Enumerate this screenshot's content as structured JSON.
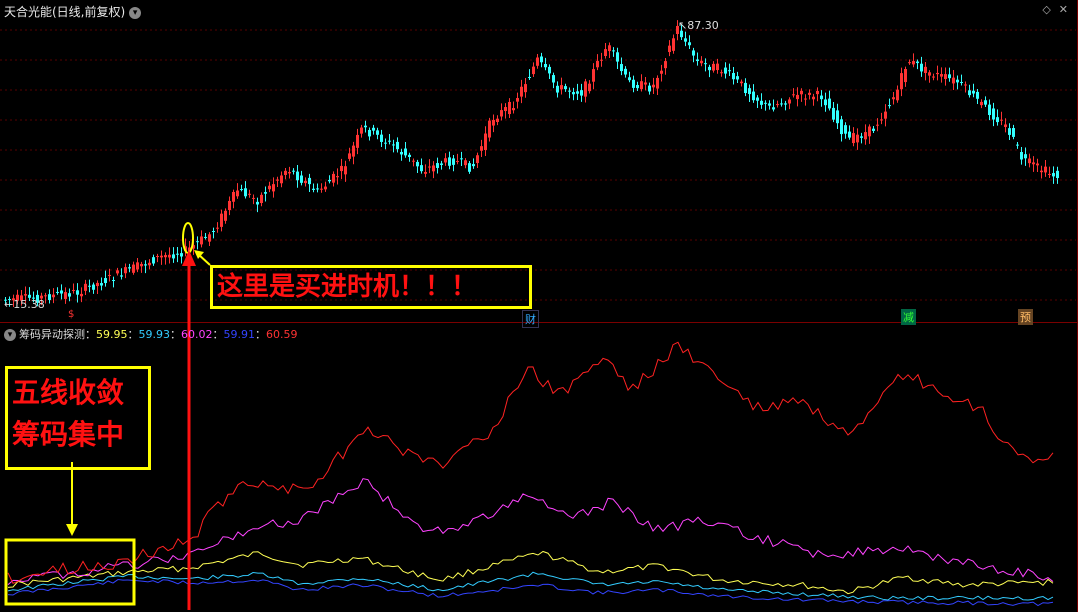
{
  "header": {
    "title": "天合光能(日线,前复权)",
    "icons": [
      "diamond-icon",
      "close-icon"
    ]
  },
  "price_labels": {
    "high": "87.30",
    "low": "15.38"
  },
  "indicator": {
    "name": "筹码异动探测",
    "values": [
      "59.95",
      "59.93",
      "60.02",
      "59.91",
      "60.59"
    ],
    "colors": [
      "#ffff55",
      "#33ccff",
      "#ff44ff",
      "#3344ff",
      "#ff3333"
    ]
  },
  "event_tags": {
    "s": "$",
    "cai": "财",
    "jian": "减",
    "yu": "预"
  },
  "annotations": {
    "buy_text": "这里是买进时机！！！",
    "five_line_1": "五线收敛",
    "five_line_2": "筹码集中"
  },
  "colors": {
    "up": "#ff3333",
    "down": "#33ffff",
    "annotation": "#ffff00",
    "arrow": "#ff1111"
  }
}
